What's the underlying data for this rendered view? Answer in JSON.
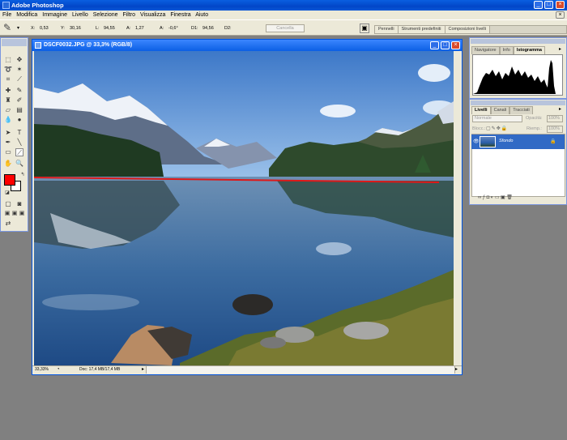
{
  "app": {
    "title": "Adobe Photoshop"
  },
  "menu": [
    "File",
    "Modifica",
    "Immagine",
    "Livello",
    "Selezione",
    "Filtro",
    "Visualizza",
    "Finestra",
    "Aiuto"
  ],
  "options_bar": {
    "x_label": "X:",
    "x_value": "0,53",
    "y_label": "Y:",
    "y_value": "30,16",
    "l_label": "L:",
    "l_value": "94,55",
    "a_label": "A:",
    "a_value": "1,27",
    "angle_label": "A:",
    "angle_value": "-0,6°",
    "d1_label": "D1:",
    "d1_value": "94,56",
    "d2_label": "D2:",
    "d2_value": "",
    "cancel_label": "Cancella"
  },
  "palette_well": [
    "Pennelli",
    "Strumenti predefiniti",
    "Composizioni livelli"
  ],
  "document": {
    "title": "DSCF0032.JPG @ 33,3% (RGB/8)",
    "zoom": "33,33%",
    "doc_size": "Doc: 17,4 MB/17,4 MB"
  },
  "nav_panel": {
    "tabs": [
      "Navigatore",
      "Info",
      "Istogramma"
    ],
    "active_tab": "Istogramma"
  },
  "layers_panel": {
    "tabs": [
      "Livelli",
      "Canali",
      "Tracciati"
    ],
    "active_tab": "Livelli",
    "blend_mode": "Normale",
    "opacity_label": "Opacità:",
    "opacity_value": "100%",
    "lock_label": "Blocc.:",
    "fill_label": "Riemp.:",
    "fill_value": "100%",
    "layers": [
      {
        "name": "Sfondo",
        "visible": true,
        "locked": true
      }
    ]
  },
  "colors": {
    "foreground": "#ff0000",
    "background": "#ffffff",
    "accent": "#0a5fe0"
  },
  "icons": {
    "tool_preset": "pencil-icon",
    "measure": "ruler-icon"
  }
}
